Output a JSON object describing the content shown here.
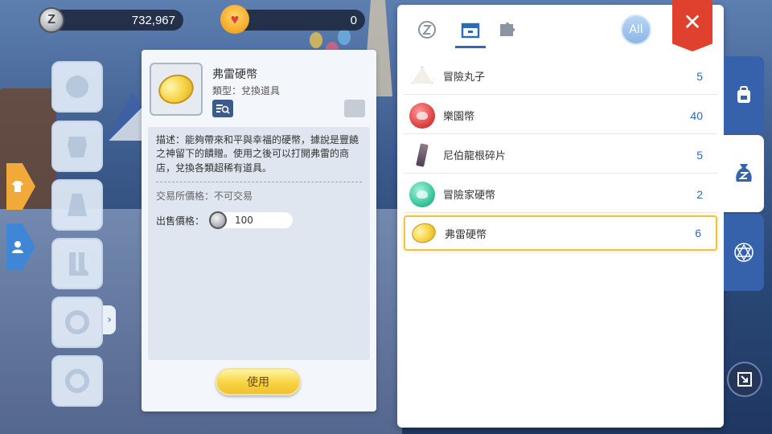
{
  "currencies": {
    "zeny": {
      "icon": "zeny-coin-icon",
      "amount": "732,967",
      "symbol": "Z"
    },
    "event": {
      "icon": "heart-badge-icon",
      "amount": "0"
    }
  },
  "item_detail": {
    "name": "弗雷硬幣",
    "type": "類型：兌換道具",
    "description": "描述：能夠帶來和平與幸福的硬幣，據說是豐饒之神留下的饋贈。使用之後可以打開弗雷的商店，兌換各類超稀有道具。",
    "trade_price": "交易所價格：不可交易",
    "sell_label": "出售價格：",
    "sell_price": "100",
    "use_button": "使用"
  },
  "inventory": {
    "tabs": [
      {
        "name": "zeny-tab",
        "icon": "zeny-circle-icon"
      },
      {
        "name": "box-tab",
        "icon": "box-icon",
        "active": true
      },
      {
        "name": "puzzle-tab",
        "icon": "puzzle-icon"
      }
    ],
    "all_label": "All",
    "close_label": "✕",
    "items": [
      {
        "label": "冒險丸子",
        "count": "5",
        "icon": "rice-ball-icon"
      },
      {
        "label": "樂園幣",
        "count": "40",
        "icon": "red-coin-icon"
      },
      {
        "label": "尼伯龍根碎片",
        "count": "5",
        "icon": "shard-icon"
      },
      {
        "label": "冒險家硬幣",
        "count": "2",
        "icon": "green-coin-icon"
      },
      {
        "label": "弗雷硬幣",
        "count": "6",
        "icon": "gold-coin-icon",
        "selected": true
      }
    ]
  },
  "colors": {
    "accent_blue": "#2d69b8",
    "close_red": "#e0412f",
    "selected_gold": "#f1c33d"
  }
}
